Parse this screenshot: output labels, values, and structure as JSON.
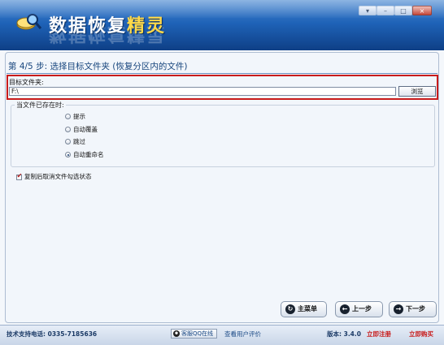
{
  "app": {
    "title_part1": "数据恢复",
    "title_part2": "精灵",
    "window_controls": [
      "▾",
      "–",
      "□",
      "×"
    ]
  },
  "step": {
    "title": "第 4/5 步: 选择目标文件夹 (恢复分区内的文件)"
  },
  "target": {
    "label": "目标文件夹:",
    "path_value": "F:\\",
    "browse_label": "浏览"
  },
  "conflict": {
    "group_label": "当文件已存在时:",
    "options": [
      {
        "label": "提示",
        "selected": false
      },
      {
        "label": "自动覆盖",
        "selected": false
      },
      {
        "label": "跳过",
        "selected": false
      },
      {
        "label": "自动重命名",
        "selected": true
      }
    ]
  },
  "option": {
    "label": "复制后取消文件勾选状态",
    "checked": true
  },
  "nav": {
    "main_menu": "主菜单",
    "prev": "上一步",
    "next": "下一步"
  },
  "footer": {
    "support_phone": "技术支持电话: 0335-7185636",
    "qq_online": "客服QQ在线",
    "reviews": "查看用户评价",
    "version": "版本: 3.4.0",
    "register": "立即注册",
    "buy": "立即购买"
  },
  "colors": {
    "banner": "#1f63b8",
    "accent_title": "#ffd94a",
    "highlight_border": "#c81b1b",
    "link_blue": "#1b4a86",
    "link_red": "#c81b1b"
  }
}
